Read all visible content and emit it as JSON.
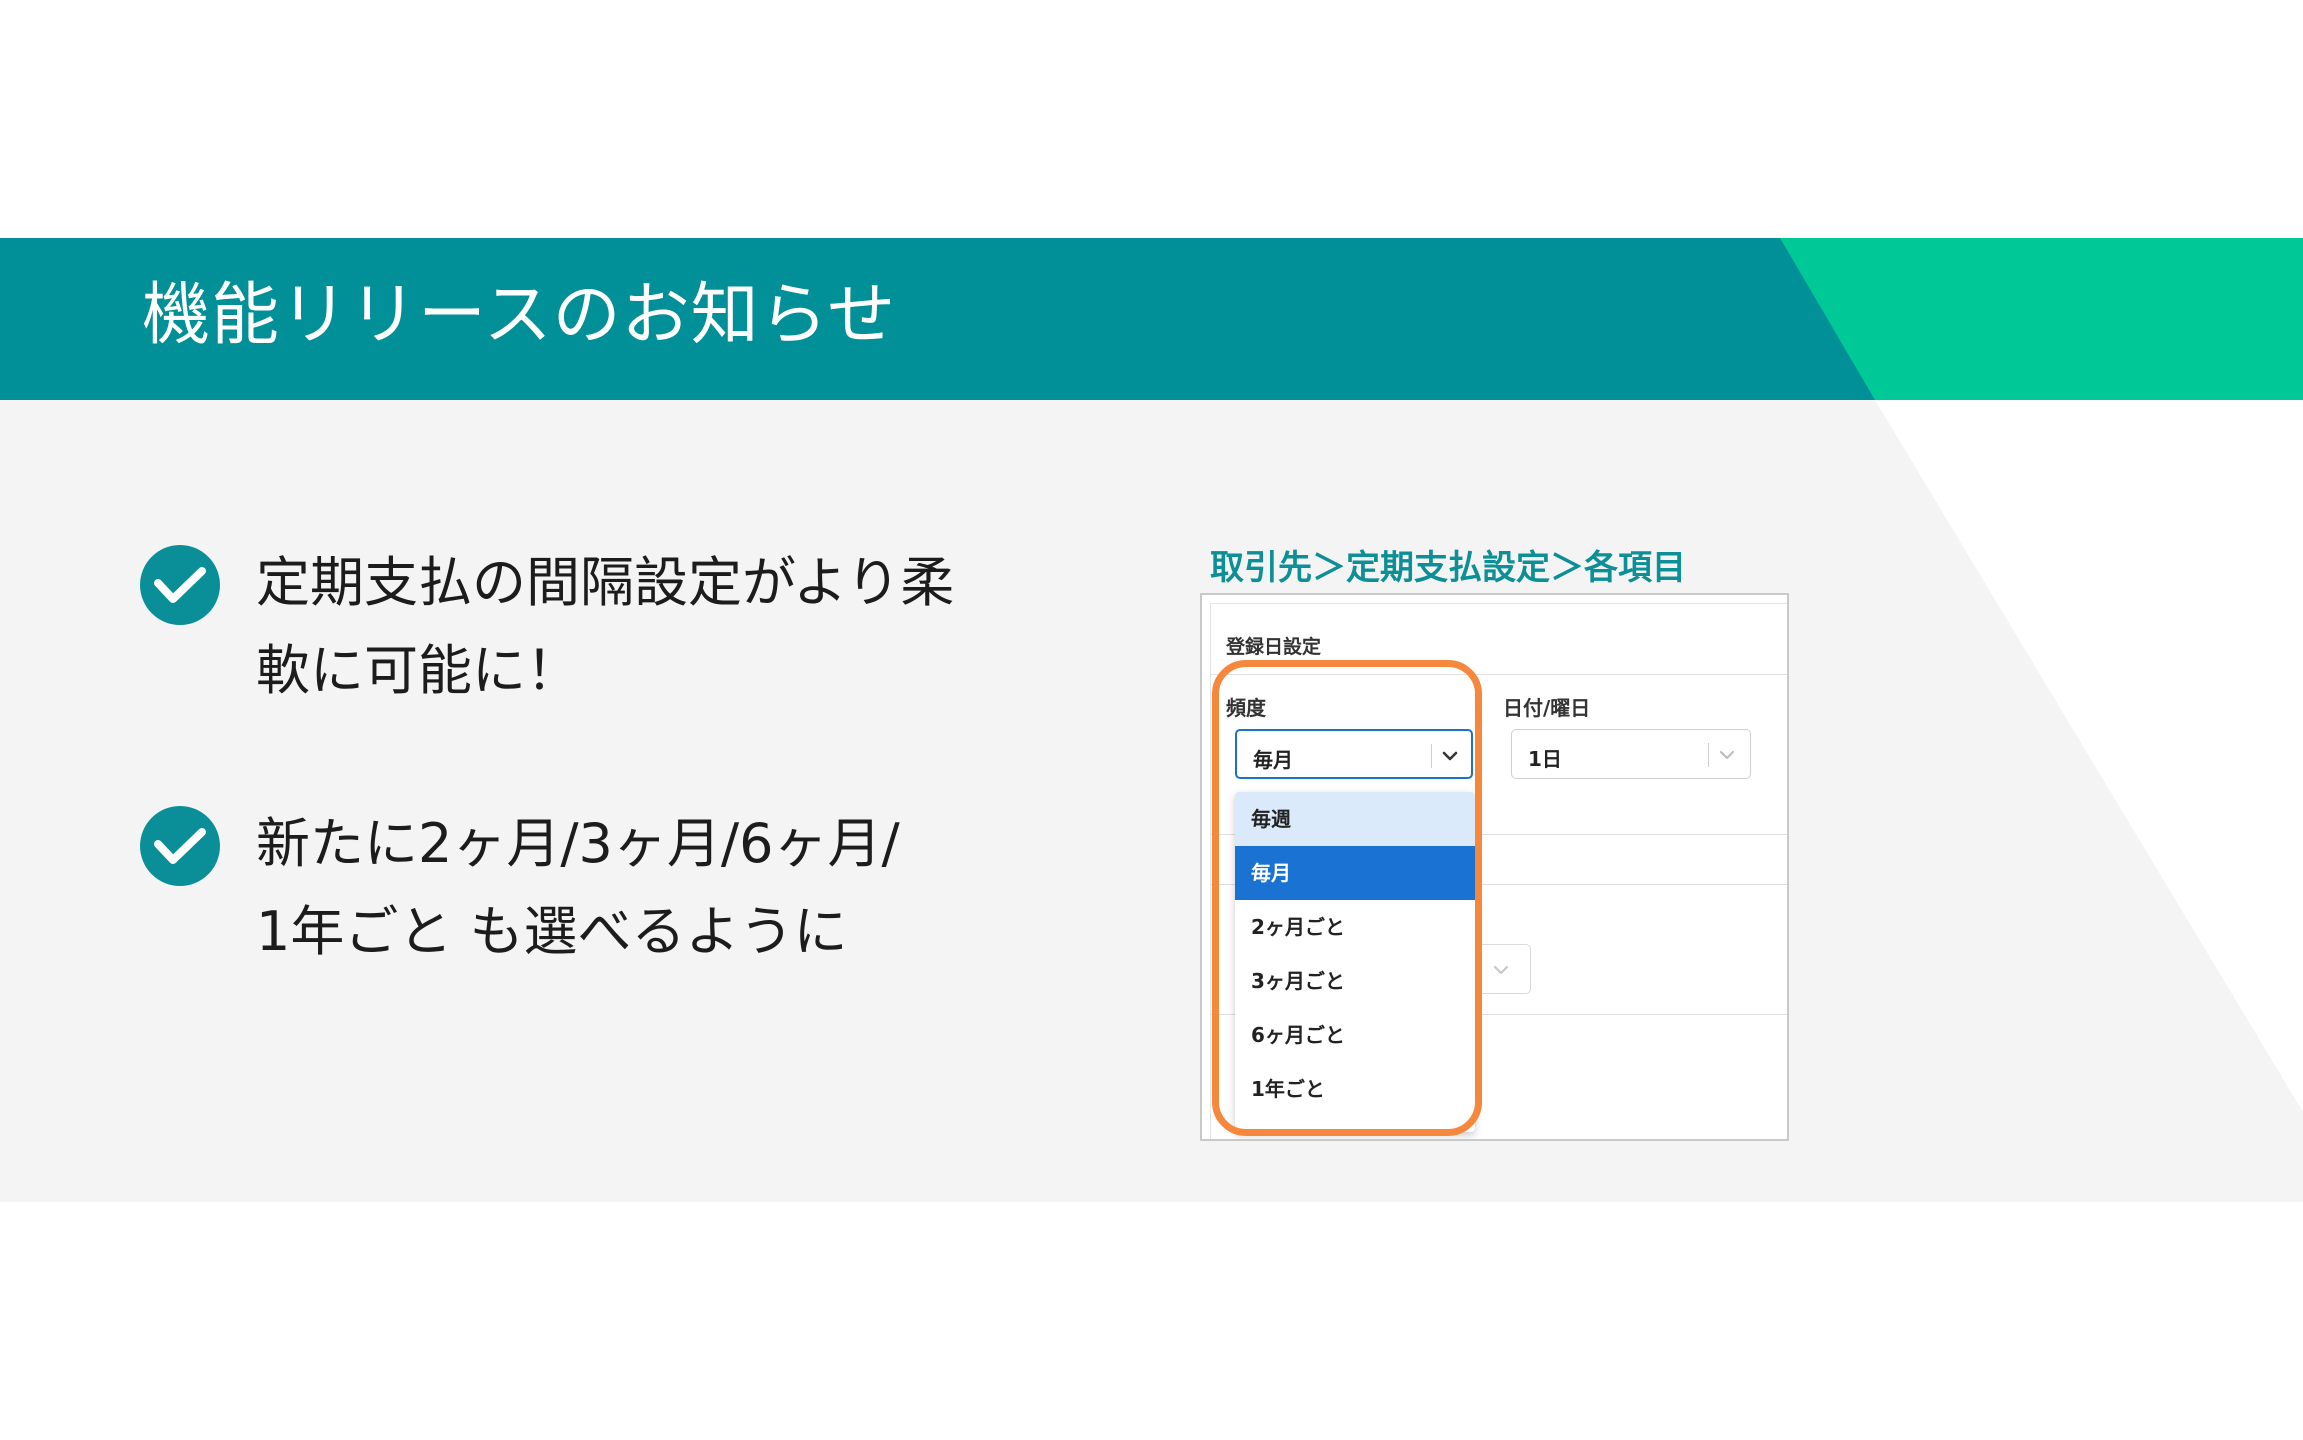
{
  "banner": {
    "title": "機能リリースのお知らせ",
    "color_primary": "#018f98",
    "color_accent": "#00c896"
  },
  "bullets": [
    {
      "icon": "check-circle-icon",
      "lines": [
        "定期支払の間隔設定がより柔",
        "軟に可能に！"
      ]
    },
    {
      "icon": "check-circle-icon",
      "lines": [
        "新たに2ヶ月/3ヶ月/6ヶ月/",
        "1年ごと も選べるように"
      ]
    }
  ],
  "screenshot": {
    "breadcrumb": "取引先＞定期支払設定＞各項目",
    "card_title": "登録日設定",
    "frequency": {
      "label": "頻度",
      "value": "毎月"
    },
    "day": {
      "label": "日付/曜日",
      "value": "1日"
    },
    "dropdown_options": [
      {
        "label": "毎週",
        "state": "hover"
      },
      {
        "label": "毎月",
        "state": "selected"
      },
      {
        "label": "2ヶ月ごと",
        "state": ""
      },
      {
        "label": "3ヶ月ごと",
        "state": ""
      },
      {
        "label": "6ヶ月ごと",
        "state": ""
      },
      {
        "label": "1年ごと",
        "state": ""
      }
    ],
    "highlight_color": "#f5883c",
    "selected_color": "#1a73d2"
  }
}
